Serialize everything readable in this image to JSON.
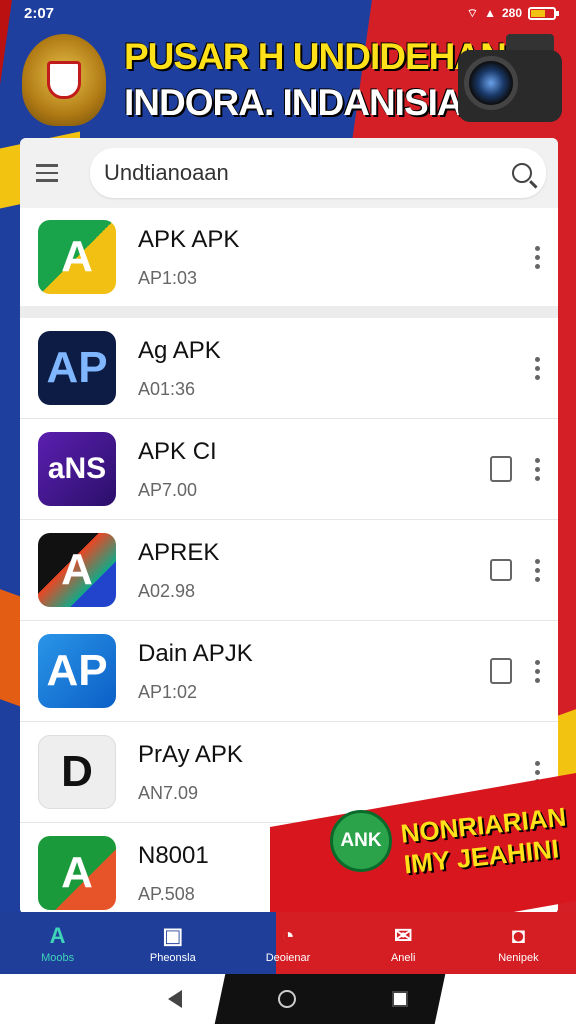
{
  "status_bar": {
    "time": "2:07",
    "battery_text": "280"
  },
  "header": {
    "title_line1": "PUSAR H UNDIDEHAN",
    "title_line2": "INDORA. INDANISIA"
  },
  "search": {
    "value": "Undtianoaan",
    "placeholder": ""
  },
  "apps": [
    {
      "name": "APK APK",
      "sub": "AP1:03",
      "icon_text": "A"
    },
    {
      "name": "Ag APK",
      "sub": "A01:36",
      "icon_text": "AP"
    },
    {
      "name": "APK CI",
      "sub": "AP7.00",
      "icon_text": "aNS"
    },
    {
      "name": "APREK",
      "sub": "A02.98",
      "icon_text": "A"
    },
    {
      "name": "Dain APJK",
      "sub": "AP1:02",
      "icon_text": "AP"
    },
    {
      "name": "PrAy APK",
      "sub": "AN7.09",
      "icon_text": "D"
    },
    {
      "name": "N8001",
      "sub": "AP.508",
      "icon_text": "A"
    }
  ],
  "promo": {
    "badge": "ANK",
    "line1": "NONRIARIAN",
    "line2": "IMY JEAHINI"
  },
  "bottom_nav": [
    {
      "label": "Moobs",
      "icon": "apps-icon"
    },
    {
      "label": "Pheonsla",
      "icon": "box-icon"
    },
    {
      "label": "Deoienar",
      "icon": "compass-icon"
    },
    {
      "label": "Aneli",
      "icon": "mail-icon"
    },
    {
      "label": "Nenipek",
      "icon": "bag-icon"
    }
  ],
  "colors": {
    "accent": "#3fd3b8",
    "blue": "#1e3e9a",
    "red": "#d41e24",
    "yellow": "#ffe11a"
  }
}
